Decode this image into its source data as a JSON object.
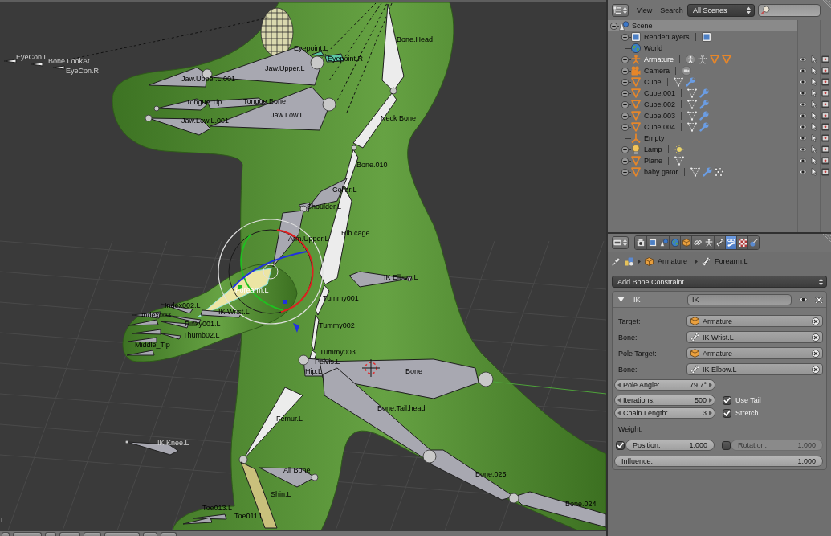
{
  "viewport": {
    "bones": [
      {
        "name": "EyeCon.L",
        "selected": false
      },
      {
        "name": "Bone.LookAt",
        "selected": false
      },
      {
        "name": "EyeCon.R",
        "selected": false
      },
      {
        "name": "Eyepoint.L",
        "selected": false
      },
      {
        "name": "Eyepoint.R",
        "selected": false
      },
      {
        "name": "Jaw.Upper.L.001",
        "selected": false
      },
      {
        "name": "Jaw.Upper.L",
        "selected": false
      },
      {
        "name": "Tongue.Tip",
        "selected": false
      },
      {
        "name": "Tongue.Bone",
        "selected": false
      },
      {
        "name": "Jaw.Low.L.001",
        "selected": false
      },
      {
        "name": "Jaw.Low.L",
        "selected": false
      },
      {
        "name": "Bone.Head",
        "selected": false
      },
      {
        "name": "Neck Bone",
        "selected": false
      },
      {
        "name": "Bone.010",
        "selected": false
      },
      {
        "name": "Collar.L",
        "selected": false
      },
      {
        "name": "Shoulder.L",
        "selected": false
      },
      {
        "name": "Arm.Upper.L",
        "selected": false
      },
      {
        "name": "Rib cage",
        "selected": false
      },
      {
        "name": "IK Elbow.L",
        "selected": false
      },
      {
        "name": "Forearm.L",
        "selected": true
      },
      {
        "name": "Tummy001",
        "selected": false
      },
      {
        "name": "Tummy002",
        "selected": false
      },
      {
        "name": "Tummy003",
        "selected": false
      },
      {
        "name": "Pelvis.L",
        "selected": false
      },
      {
        "name": "Hip.L",
        "selected": false
      },
      {
        "name": "Bone",
        "selected": false
      },
      {
        "name": "Bone.Tail.head",
        "selected": false
      },
      {
        "name": "Femur.L",
        "selected": false
      },
      {
        "name": "IK Knee.L",
        "selected": false
      },
      {
        "name": "All Bone",
        "selected": false
      },
      {
        "name": "Shin.L",
        "selected": false
      },
      {
        "name": "Bone.025",
        "selected": false
      },
      {
        "name": "Bone.024",
        "selected": false
      },
      {
        "name": "Index002.L",
        "selected": false
      },
      {
        "name": "Index003",
        "selected": false
      },
      {
        "name": "IK Wrist.L",
        "selected": false
      },
      {
        "name": "Pinky001.L",
        "selected": false
      },
      {
        "name": "Thumb02.L",
        "selected": false
      },
      {
        "name": "Middle_Tip",
        "selected": false
      },
      {
        "name": "Toe011.L",
        "selected": false
      },
      {
        "name": "L",
        "selected": false
      },
      {
        "name": "Toe013.L",
        "selected": false
      }
    ]
  },
  "outliner": {
    "menus": [
      "View",
      "Search"
    ],
    "scene_filter": "All Scenes",
    "tree": [
      {
        "name": "Scene",
        "kind": "scene",
        "expanded": true,
        "selected": true,
        "active": false,
        "children": [
          {
            "name": "RenderLayers",
            "kind": "renderlayers",
            "expanded": false,
            "selected": false,
            "active": false,
            "collapsed": [
              {
                "kind": "renderlayer"
              }
            ]
          },
          {
            "name": "World",
            "kind": "world",
            "selected": false,
            "active": false
          },
          {
            "name": "Armature",
            "kind": "armature",
            "expanded": false,
            "selected": false,
            "active": true,
            "collapsed": [
              {
                "kind": "armature_data"
              },
              {
                "kind": "pose"
              },
              {
                "kind": "mesh"
              },
              {
                "kind": "mesh"
              }
            ],
            "restrict": {
              "visible": true,
              "selectable": true,
              "renderable": true
            }
          },
          {
            "name": "Camera",
            "kind": "camera",
            "expanded": false,
            "selected": false,
            "active": false,
            "collapsed": [
              {
                "kind": "camera_data"
              }
            ],
            "restrict": {
              "visible": true,
              "selectable": true,
              "renderable": true
            }
          },
          {
            "name": "Cube",
            "kind": "mesh",
            "expanded": false,
            "selected": false,
            "active": false,
            "collapsed": [
              {
                "kind": "mesh_data"
              },
              {
                "kind": "modifier"
              }
            ],
            "restrict": {
              "visible": true,
              "selectable": true,
              "renderable": true
            }
          },
          {
            "name": "Cube.001",
            "kind": "mesh",
            "expanded": false,
            "selected": false,
            "active": false,
            "collapsed": [
              {
                "kind": "mesh_data"
              },
              {
                "kind": "modifier"
              }
            ],
            "restrict": {
              "visible": true,
              "selectable": true,
              "renderable": true
            }
          },
          {
            "name": "Cube.002",
            "kind": "mesh",
            "expanded": false,
            "selected": false,
            "active": false,
            "collapsed": [
              {
                "kind": "mesh_data"
              },
              {
                "kind": "modifier"
              }
            ],
            "restrict": {
              "visible": true,
              "selectable": true,
              "renderable": true
            }
          },
          {
            "name": "Cube.003",
            "kind": "mesh",
            "expanded": false,
            "selected": false,
            "active": false,
            "collapsed": [
              {
                "kind": "mesh_data"
              },
              {
                "kind": "modifier"
              }
            ],
            "restrict": {
              "visible": true,
              "selectable": true,
              "renderable": true
            }
          },
          {
            "name": "Cube.004",
            "kind": "mesh",
            "expanded": false,
            "selected": false,
            "active": false,
            "collapsed": [
              {
                "kind": "mesh_data"
              },
              {
                "kind": "modifier"
              }
            ],
            "restrict": {
              "visible": true,
              "selectable": true,
              "renderable": true
            }
          },
          {
            "name": "Empty",
            "kind": "empty",
            "selected": false,
            "active": false,
            "restrict": {
              "visible": true,
              "selectable": true,
              "renderable": true
            }
          },
          {
            "name": "Lamp",
            "kind": "lamp",
            "expanded": false,
            "selected": false,
            "active": false,
            "collapsed": [
              {
                "kind": "lamp_data"
              }
            ],
            "restrict": {
              "visible": true,
              "selectable": true,
              "renderable": true
            }
          },
          {
            "name": "Plane",
            "kind": "mesh",
            "expanded": false,
            "selected": false,
            "active": false,
            "collapsed": [
              {
                "kind": "mesh_data"
              }
            ],
            "restrict": {
              "visible": true,
              "selectable": true,
              "renderable": true
            }
          },
          {
            "name": "baby gator",
            "kind": "mesh",
            "expanded": false,
            "selected": false,
            "active": false,
            "collapsed": [
              {
                "kind": "mesh_data"
              },
              {
                "kind": "modifier"
              },
              {
                "kind": "particles"
              }
            ],
            "restrict": {
              "visible": true,
              "selectable": true,
              "renderable": true
            }
          }
        ]
      }
    ]
  },
  "properties": {
    "tabs": [
      {
        "kind": "render",
        "selected": false
      },
      {
        "kind": "render_layers",
        "selected": false
      },
      {
        "kind": "scene",
        "selected": false
      },
      {
        "kind": "world",
        "selected": false
      },
      {
        "kind": "object",
        "selected": false
      },
      {
        "kind": "constraints",
        "selected": false
      },
      {
        "kind": "data",
        "selected": false
      },
      {
        "kind": "bone",
        "selected": false
      },
      {
        "kind": "bone_constraints",
        "selected": true
      },
      {
        "kind": "texture",
        "selected": false
      },
      {
        "kind": "physics",
        "selected": false
      }
    ],
    "breadcrumb": [
      {
        "kind": "armature"
      },
      {
        "kind": "object",
        "label": "Armature"
      },
      {
        "kind": "bone",
        "label": "Forearm.L"
      }
    ],
    "add_constraint": "Add Bone Constraint",
    "constraint": {
      "type_label": "IK",
      "name": "IK",
      "expanded": true,
      "visible": true,
      "fields": [
        {
          "label": "Target:",
          "kind": "object",
          "value": "Armature"
        },
        {
          "label": "Bone:",
          "kind": "bone",
          "value": "IK Wrist.L"
        },
        {
          "label": "Pole Target:",
          "kind": "object",
          "value": "Armature"
        },
        {
          "label": "Bone:",
          "kind": "bone",
          "value": "IK Elbow.L"
        }
      ],
      "pole_angle": {
        "label": "Pole Angle:",
        "value": "79.7°"
      },
      "rows": [
        {
          "number": {
            "label": "Iterations:",
            "value": "500"
          },
          "option": {
            "label": "Use Tail",
            "checked": true
          }
        },
        {
          "number": {
            "label": "Chain Length:",
            "value": "3"
          },
          "option": {
            "label": "Stretch",
            "checked": true
          }
        }
      ],
      "weight_label": "Weight:",
      "weights": [
        {
          "label": "Position:",
          "value": "1.000",
          "checked": true
        },
        {
          "label": "Rotation:",
          "value": "1.000",
          "checked": false
        }
      ],
      "influence": {
        "label": "Influence:",
        "value": "1.000"
      }
    }
  }
}
